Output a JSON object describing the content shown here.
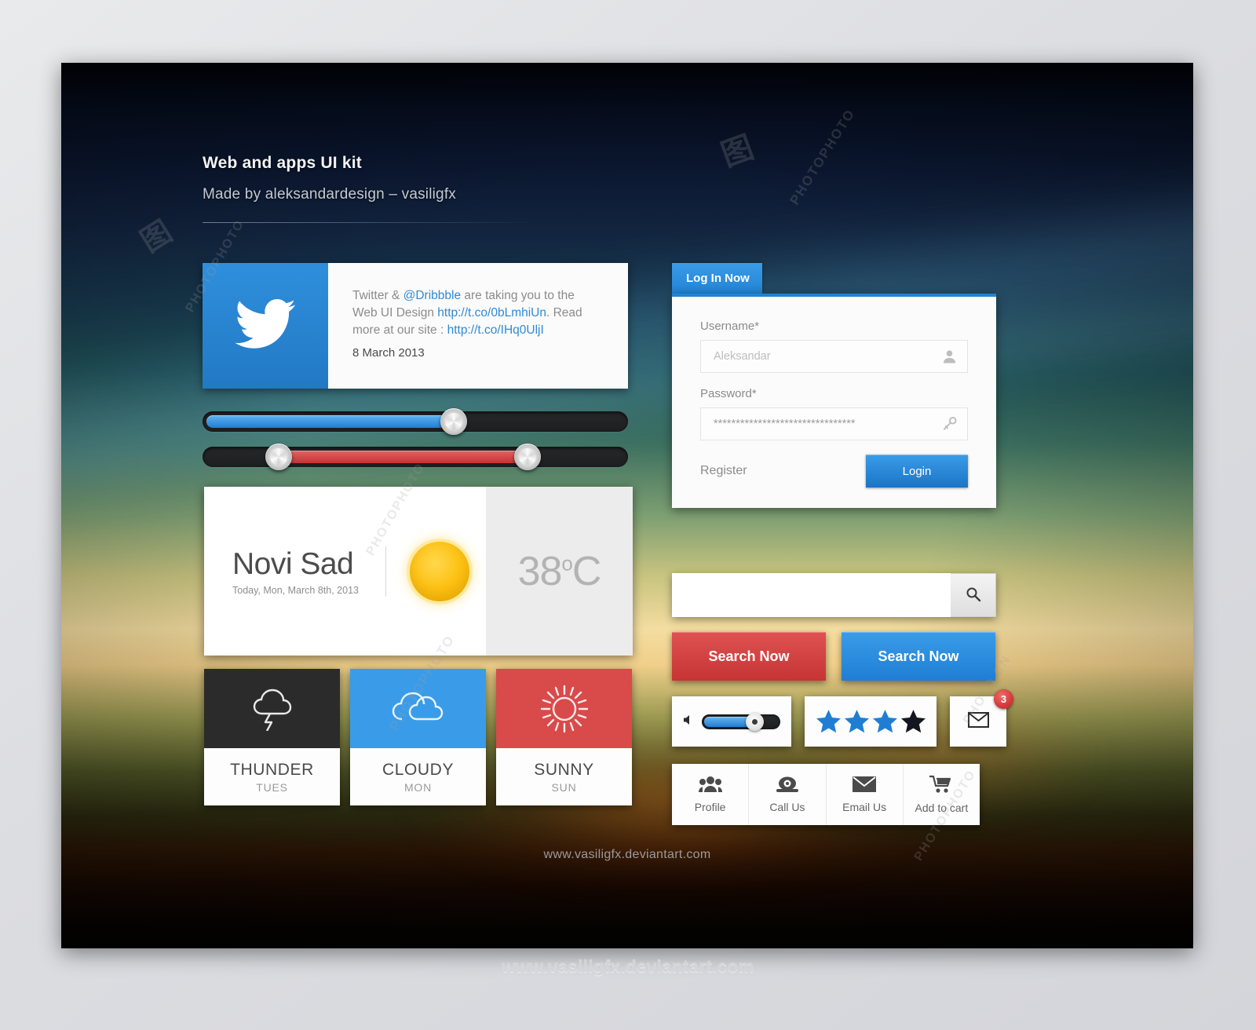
{
  "header": {
    "title": "Web and apps UI kit",
    "subtitle": "Made by aleksandardesign – vasiligfx"
  },
  "twitter_card": {
    "icon": "twitter-bird-icon",
    "text_part1": "Twitter & ",
    "handle": "@Dribbble",
    "text_part2": " are taking you to the Web UI Design ",
    "link1": "http://t.co/0bLmhiUn",
    "text_part3": ". Read more at our site : ",
    "link2": "http://t.co/IHq0UljI",
    "date": "8 March 2013"
  },
  "sliders": [
    {
      "name": "blue-slider",
      "type": "single",
      "value": 60,
      "color": "#1f7ed4"
    },
    {
      "name": "red-range-slider",
      "type": "range",
      "start": 18,
      "end": 78,
      "color": "#c33333"
    }
  ],
  "weather": {
    "city": "Novi Sad",
    "date": "Today, Mon, March 8th, 2013",
    "icon": "sun-icon",
    "temperature": "38",
    "degree": "o",
    "unit": "C"
  },
  "forecast": [
    {
      "day": "THUNDER",
      "sub": "TUES",
      "icon": "thunder-cloud-icon",
      "color": "#2b2b2b"
    },
    {
      "day": "CLOUDY",
      "sub": "MON",
      "icon": "cloud-icon",
      "color": "#3a9ce8"
    },
    {
      "day": "SUNNY",
      "sub": "SUN",
      "icon": "sun-rays-icon",
      "color": "#d94a4a"
    }
  ],
  "login": {
    "tab_label": "Log In Now",
    "username_label": "Username*",
    "username_placeholder": "Aleksandar",
    "username_value": "",
    "username_icon": "user-icon",
    "password_label": "Password*",
    "password_value": "********************************",
    "password_icon": "key-icon",
    "register_label": "Register",
    "login_button": "Login"
  },
  "search": {
    "placeholder": "",
    "value": "",
    "icon": "search-icon",
    "button_red": "Search Now",
    "button_blue": "Search Now"
  },
  "widgets": {
    "volume": {
      "icon": "speaker-icon",
      "value": 62
    },
    "rating": {
      "total": 4,
      "filled": 3,
      "filled_color": "#1f7ed4",
      "empty_color": "#14161f"
    },
    "mail": {
      "icon": "envelope-icon",
      "badge": "3"
    }
  },
  "icon_bar": [
    {
      "label": "Profile",
      "icon": "people-icon"
    },
    {
      "label": "Call Us",
      "icon": "phone-icon"
    },
    {
      "label": "Email Us",
      "icon": "envelope-icon"
    },
    {
      "label": "Add to cart",
      "icon": "cart-icon"
    }
  ],
  "footers": {
    "canvas": "www.vasiligfx.deviantart.com",
    "outer": "www.vasiligfx.deviantart.com"
  },
  "colors": {
    "accent_blue": "#2183d3",
    "accent_red": "#c63434",
    "dark": "#2b2b2b"
  }
}
